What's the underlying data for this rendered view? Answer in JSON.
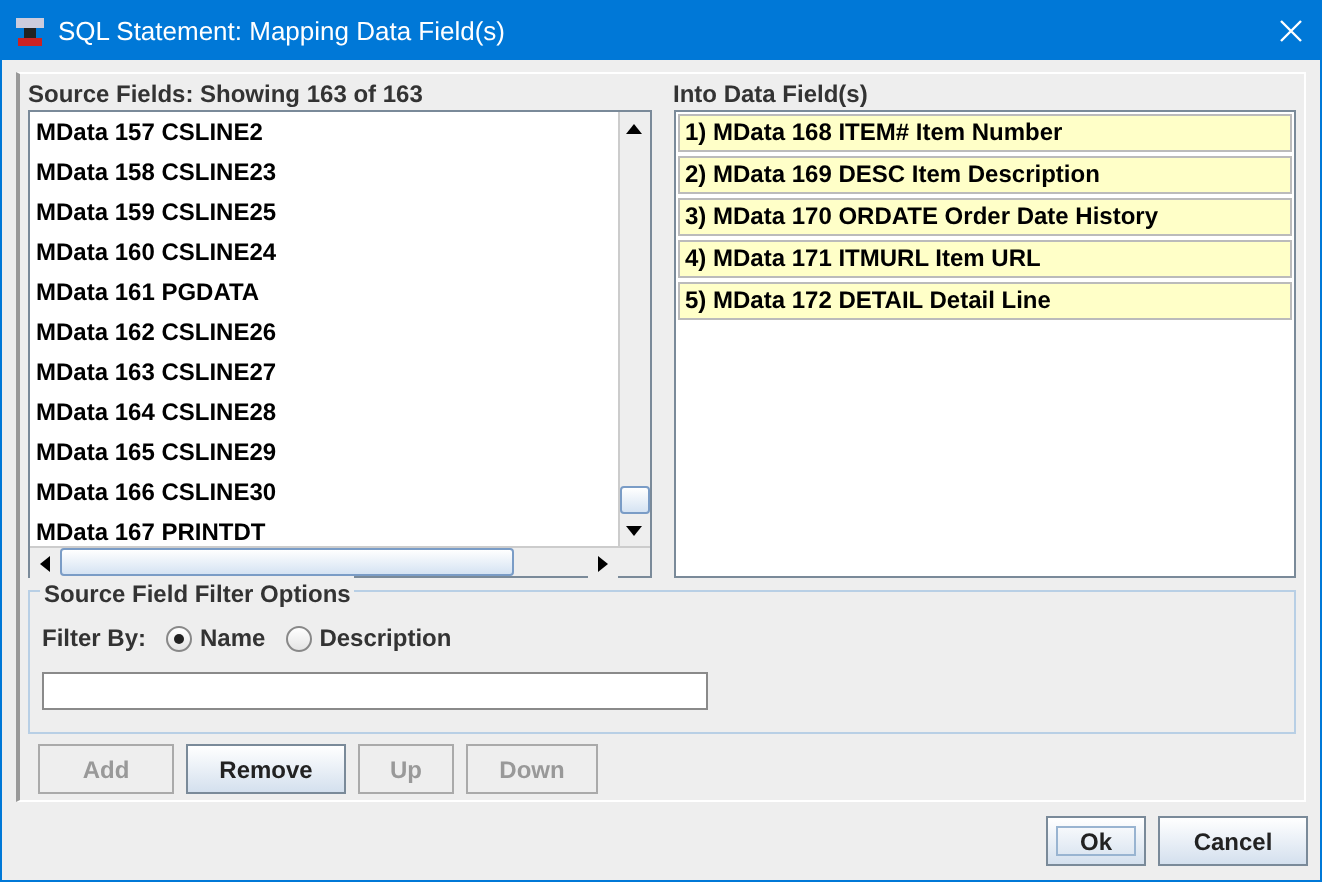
{
  "window": {
    "title": "SQL Statement: Mapping Data Field(s)"
  },
  "source_fields": {
    "label": "Source Fields: Showing 163 of 163",
    "items": [
      "MData 157 CSLINE2",
      "MData 158 CSLINE23",
      "MData 159 CSLINE25",
      "MData 160 CSLINE24",
      "MData 161 PGDATA",
      "MData 162 CSLINE26",
      "MData 163 CSLINE27",
      "MData 164 CSLINE28",
      "MData 165 CSLINE29",
      "MData 166 CSLINE30",
      "MData 167 PRINTDT"
    ]
  },
  "into_fields": {
    "label": "Into Data Field(s)",
    "items": [
      "1) MData 168 ITEM# Item Number",
      "2) MData 169 DESC Item Description",
      "3) MData 170 ORDATE Order Date History",
      "4) MData 171 ITMURL Item URL",
      "5) MData 172 DETAIL Detail Line"
    ]
  },
  "filter": {
    "title": "Source Field Filter Options",
    "label": "Filter By:",
    "options": [
      {
        "label": "Name",
        "selected": true
      },
      {
        "label": "Description",
        "selected": false
      }
    ]
  },
  "buttons": [
    {
      "label": "Add",
      "disabled": true
    },
    {
      "label": "Remove",
      "disabled": false
    },
    {
      "label": "Up",
      "disabled": true
    },
    {
      "label": "Down",
      "disabled": true
    }
  ],
  "dialog_buttons": [
    {
      "label": "Ok",
      "focused": true
    },
    {
      "label": "Cancel",
      "focused": false
    }
  ]
}
